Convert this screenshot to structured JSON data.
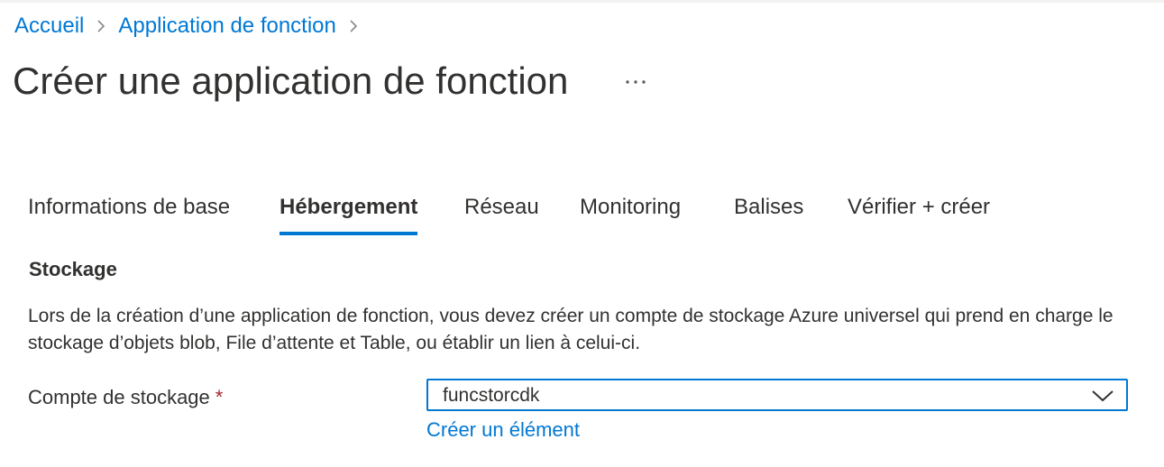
{
  "breadcrumb": {
    "items": [
      {
        "label": "Accueil"
      },
      {
        "label": "Application de fonction"
      }
    ]
  },
  "header": {
    "title": "Créer une application de fonction",
    "more_label": "···"
  },
  "tabs": [
    {
      "label": "Informations de base",
      "active": false
    },
    {
      "label": "Hébergement",
      "active": true
    },
    {
      "label": "Réseau",
      "active": false
    },
    {
      "label": "Monitoring",
      "active": false
    },
    {
      "label": "Balises",
      "active": false
    },
    {
      "label": "Vérifier + créer",
      "active": false
    }
  ],
  "storage": {
    "section_title": "Stockage",
    "description": "Lors de la création d’une application de fonction, vous devez créer un compte de stockage Azure universel qui prend en charge le stockage d’objets blob, File d’attente et Table, ou établir un lien à celui-ci.",
    "account_label": "Compte de stockage",
    "required_marker": "*",
    "account_value": "funcstorcdk",
    "create_link": "Créer un élément"
  },
  "colors": {
    "accent": "#0078d4",
    "text": "#323130",
    "required": "#a4262c"
  },
  "icons": {
    "breadcrumb_separator": "chevron-right-icon",
    "select_dropdown": "chevron-down-icon",
    "more": "more-icon"
  }
}
